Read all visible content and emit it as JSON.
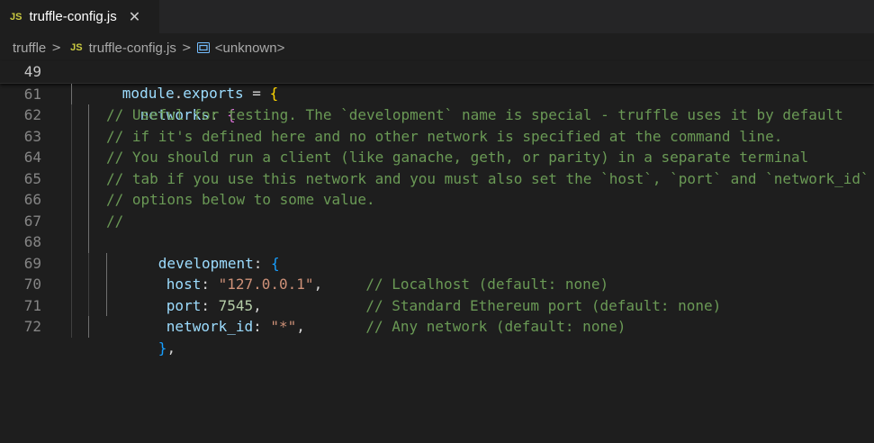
{
  "tab": {
    "badge": "JS",
    "filename": "truffle-config.js",
    "close": "✕"
  },
  "breadcrumb": {
    "folder": "truffle",
    "sep": ">",
    "badge": "JS",
    "file": "truffle-config.js",
    "symbol": "<unknown>"
  },
  "sticky": {
    "line": "49",
    "module": "module",
    "dot": ".",
    "exports": "exports",
    "eq": " = ",
    "brace": "{"
  },
  "lines": {
    "l61": {
      "num": "61",
      "key": "networks",
      "colon": ": ",
      "brace": "{"
    },
    "l62": {
      "num": "62",
      "text": "// Useful for testing. The `development` name is special - truffle uses it by default"
    },
    "l63": {
      "num": "63",
      "text": "// if it's defined here and no other network is specified at the command line."
    },
    "l64": {
      "num": "64",
      "text": "// You should run a client (like ganache, geth, or parity) in a separate terminal"
    },
    "l65": {
      "num": "65",
      "text": "// tab if you use this network and you must also set the `host`, `port` and `network_id`"
    },
    "l66": {
      "num": "66",
      "text": "// options below to some value."
    },
    "l67": {
      "num": "67",
      "text": "//"
    },
    "l68": {
      "num": "68",
      "key": "development",
      "colon": ": ",
      "brace": "{"
    },
    "l69": {
      "num": "69",
      "key": "host",
      "colon": ": ",
      "value": "\"127.0.0.1\"",
      "trail": ",     ",
      "comment": "// Localhost (default: none)"
    },
    "l70": {
      "num": "70",
      "key": "port",
      "colon": ": ",
      "value": "7545",
      "trail": ",            ",
      "comment": "// Standard Ethereum port (default: none)"
    },
    "l71": {
      "num": "71",
      "key": "network_id",
      "colon": ": ",
      "value": "\"*\"",
      "trail": ",       ",
      "comment": "// Any network (default: none)"
    },
    "l72": {
      "num": "72",
      "brace": "}",
      "trail": ","
    }
  },
  "colors": {
    "background": "#1e1e1e",
    "keyword_var": "#9cdcfe",
    "string": "#ce9178",
    "number": "#b5cea8",
    "comment": "#6a9955",
    "js_badge": "#cbcb41"
  }
}
